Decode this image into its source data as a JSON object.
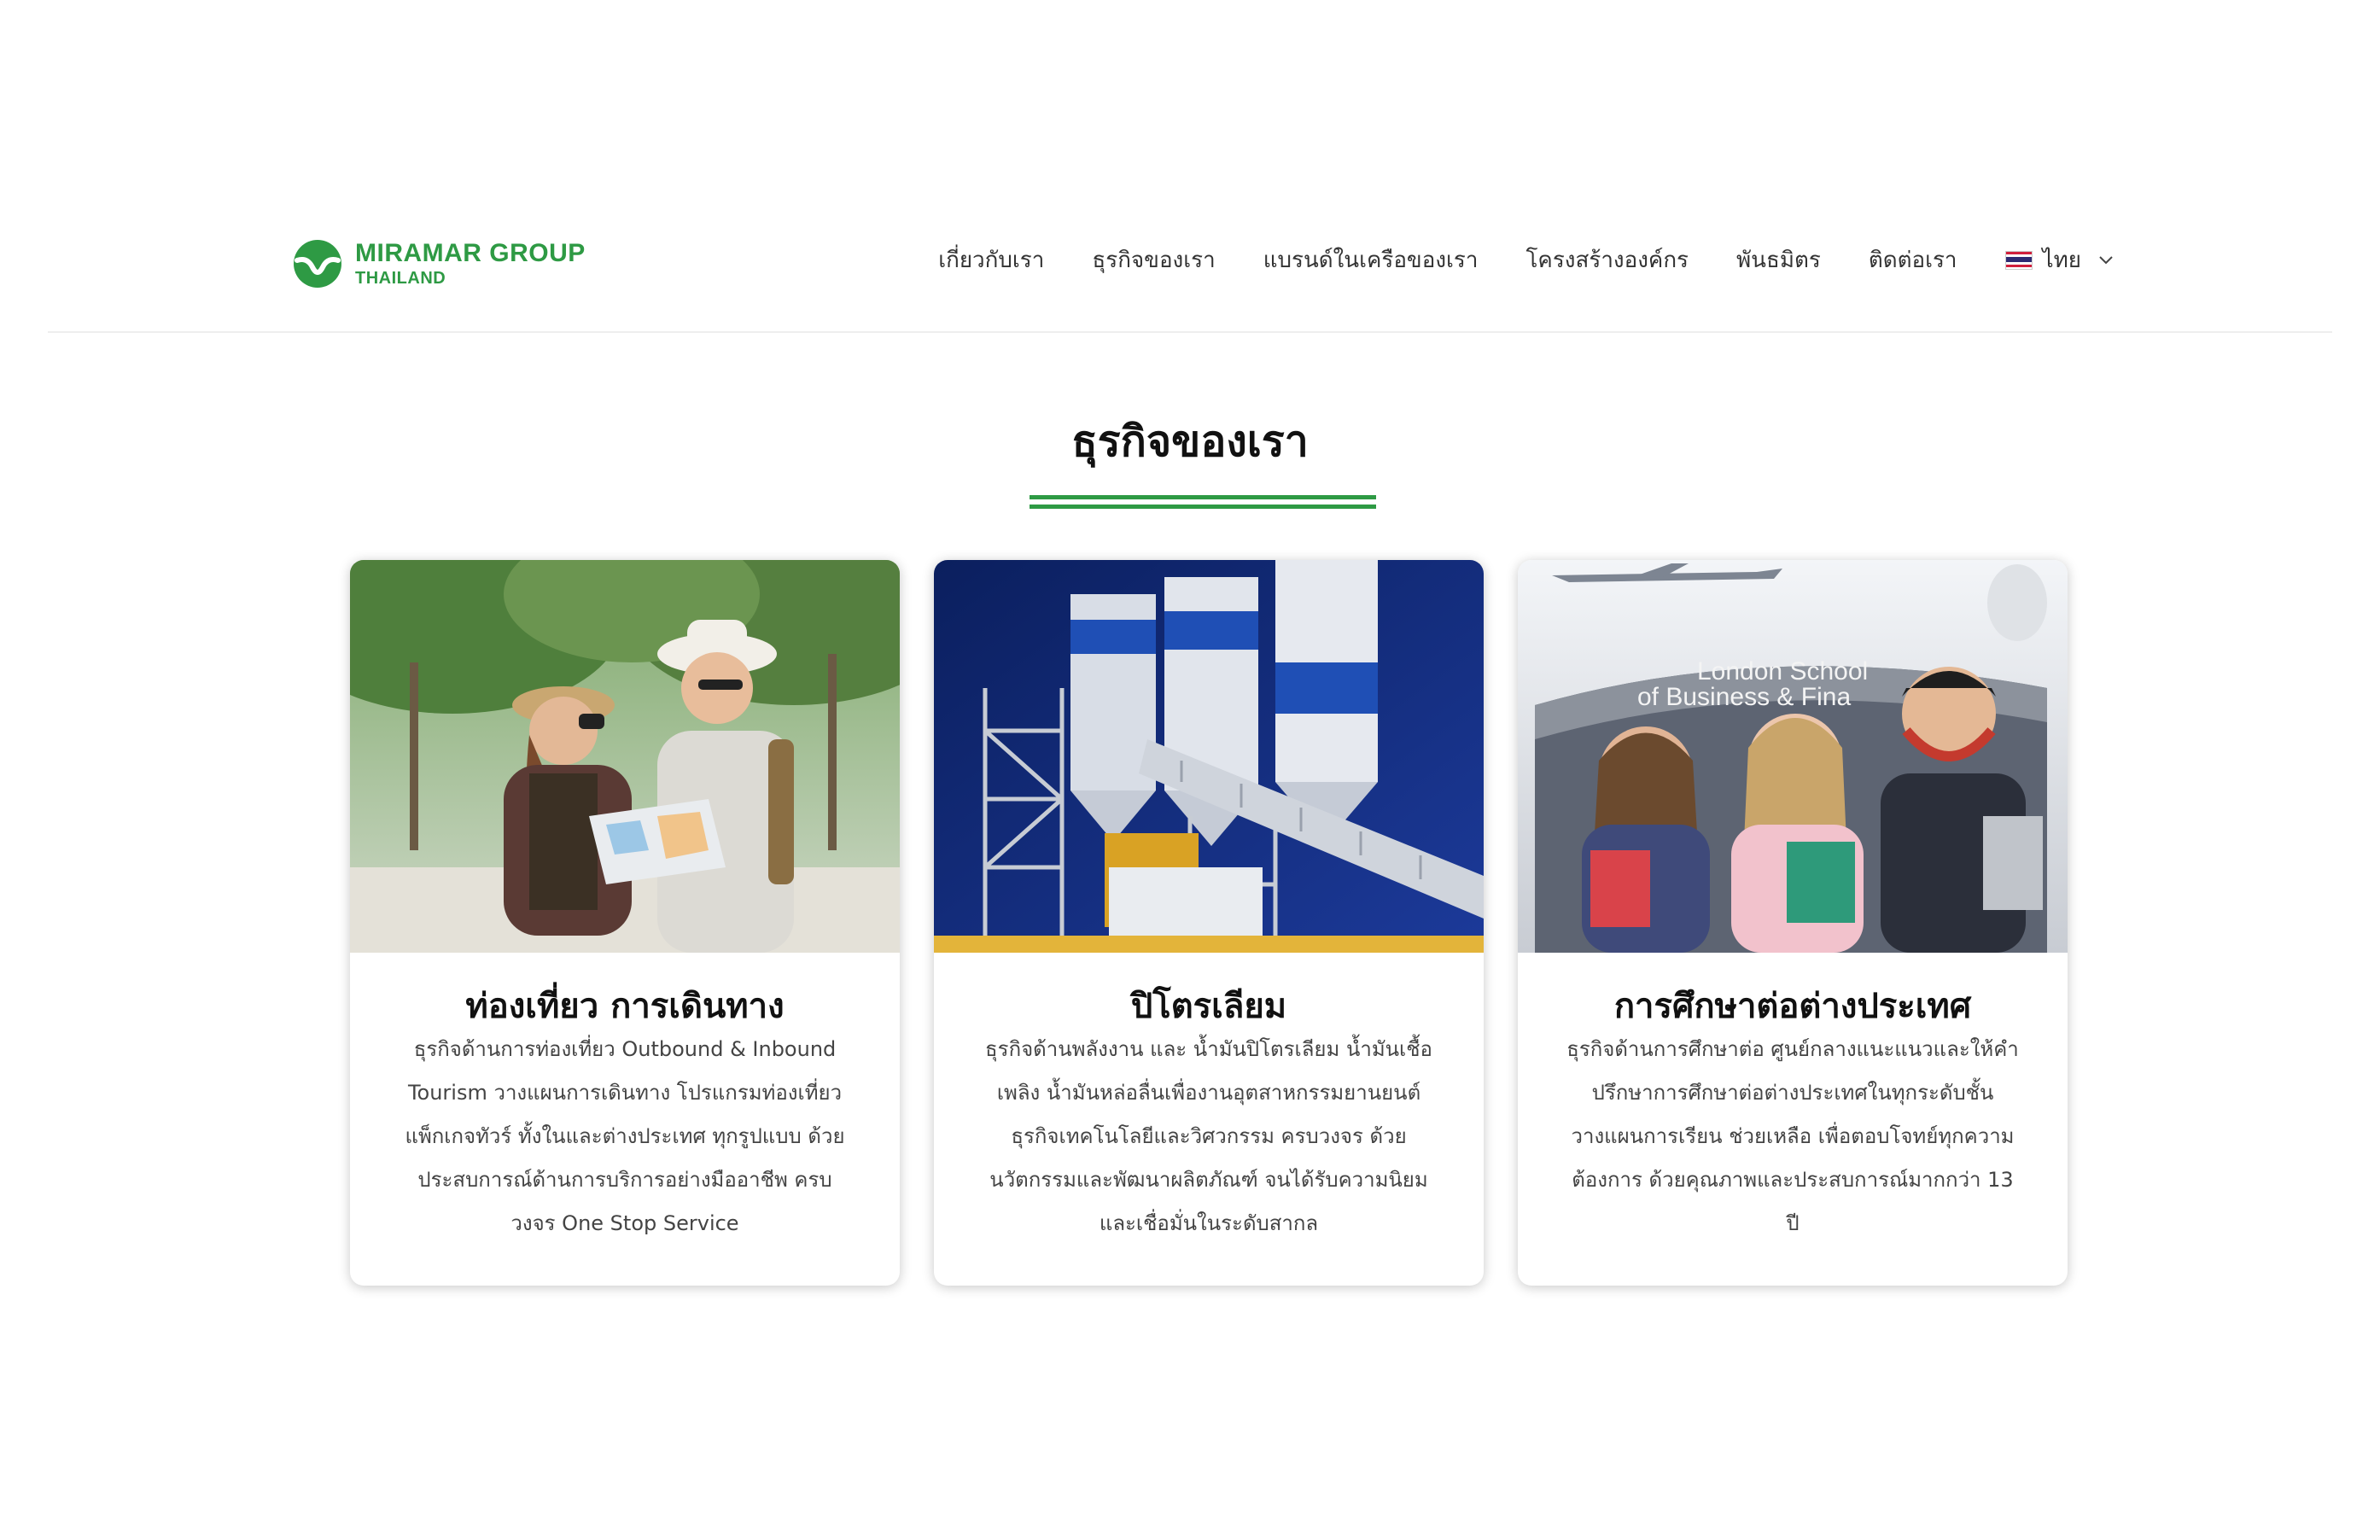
{
  "header": {
    "logo": {
      "main": "MIRAMAR GROUP",
      "sub": "THAILAND",
      "color": "#2e9a44"
    },
    "nav": [
      {
        "label": "เกี่ยวกับเรา"
      },
      {
        "label": "ธุรกิจของเรา"
      },
      {
        "label": "แบรนด์ในเครือของเรา"
      },
      {
        "label": "โครงสร้างองค์กร"
      },
      {
        "label": "พันธมิตร"
      },
      {
        "label": "ติดต่อเรา"
      }
    ],
    "language": {
      "label": "ไทย",
      "icon": "thai-flag-icon"
    }
  },
  "section": {
    "title": "ธุรกิจของเรา",
    "accent": "#2e9a44"
  },
  "cards": [
    {
      "title": "ท่องเที่ยว การเดินทาง",
      "description": "ธุรกิจด้านการท่องเที่ยว Outbound & Inbound Tourism วางแผนการเดินทาง โปรแกรมท่องเที่ยว แพ็กเกจทัวร์ ทั้งในและต่างประเทศ ทุกรูปแบบ ด้วยประสบการณ์ด้านการบริการอย่างมืออาชีพ ครบวงจร One Stop Service"
    },
    {
      "title": "ปิโตรเลียม",
      "description": "ธุรกิจด้านพลังงาน และ น้ำมันปิโตรเลียม น้ำมันเชื้อเพลิง น้ำมันหล่อลื่นเพื่องานอุตสาหกรรมยานยนต์ ธุรกิจเทคโนโลยีและวิศวกรรม ครบวงจร ด้วยนวัตกรรมและพัฒนาผลิตภัณฑ์ จนได้รับความนิยม และเชื่อมั่นในระดับสากล"
    },
    {
      "title": "การศึกษาต่อต่างประเทศ",
      "description": "ธุรกิจด้านการศึกษาต่อ ศูนย์กลางแนะแนวและให้คำปรึกษาการศึกษาต่อต่างประเทศในทุกระดับชั้น วางแผนการเรียน ช่วยเหลือ เพื่อตอบโจทย์ทุกความต้องการ ด้วยคุณภาพและประสบการณ์มากกว่า 13 ปี",
      "image_sign": [
        "London School",
        "of Business & Fina"
      ]
    }
  ]
}
